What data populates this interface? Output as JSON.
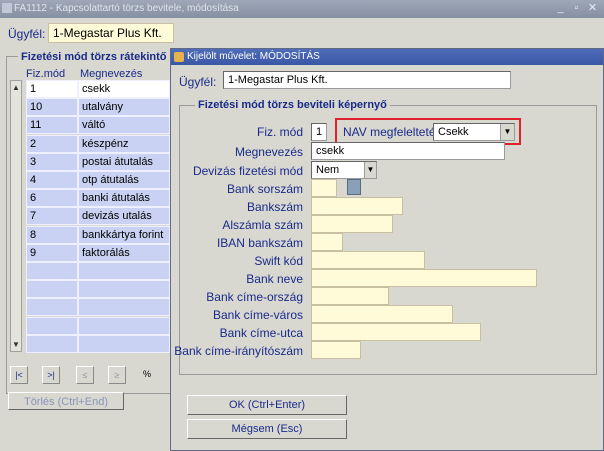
{
  "back_window": {
    "title": "FA1112 - Kapcsolattartó törzs bevitele, módosítása",
    "ugyfel_label": "Ügyfél:",
    "ugyfel_value": "1-Megastar Plus Kft.",
    "table_title": "Fizetési mód törzs rátekintő k",
    "columns": [
      "Fiz.mód",
      "Megnevezés"
    ],
    "rows": [
      {
        "code": "1",
        "name": "csekk"
      },
      {
        "code": "10",
        "name": "utalvány"
      },
      {
        "code": "11",
        "name": "váltó"
      },
      {
        "code": "2",
        "name": "készpénz"
      },
      {
        "code": "3",
        "name": "postai átutalás"
      },
      {
        "code": "4",
        "name": "otp átutalás"
      },
      {
        "code": "6",
        "name": "banki átutalás"
      },
      {
        "code": "7",
        "name": "devizás utalás"
      },
      {
        "code": "8",
        "name": "bankkártya forint"
      },
      {
        "code": "9",
        "name": "faktorálás"
      }
    ],
    "nav_buttons": [
      "|<",
      ">|",
      "≤",
      "≥",
      "%"
    ],
    "delete_button": "Törlés (Ctrl+End)"
  },
  "front_window": {
    "title": "Kijelölt művelet: MÓDOSÍTÁS",
    "ugyfel_label": "Ügyfél:",
    "ugyfel_value": "1-Megastar Plus Kft.",
    "group_title": "Fizetési mód törzs beviteli képernyő",
    "fields": {
      "fiz_mod": {
        "label": "Fiz. mód",
        "value": "1"
      },
      "nav": {
        "label": "NAV megfeleltetés",
        "value": "Csekk"
      },
      "megnevezes": {
        "label": "Megnevezés",
        "value": "csekk"
      },
      "deviza": {
        "label": "Devizás fizetési mód",
        "value": "Nem"
      },
      "bank_sorszam": {
        "label": "Bank sorszám",
        "value": ""
      },
      "bankszam": {
        "label": "Bankszám",
        "value": ""
      },
      "alszamla": {
        "label": "Alszámla szám",
        "value": ""
      },
      "iban": {
        "label": "IBAN bankszám",
        "value": ""
      },
      "swift": {
        "label": "Swift kód",
        "value": ""
      },
      "bank_neve": {
        "label": "Bank neve",
        "value": ""
      },
      "orszag": {
        "label": "Bank címe-ország",
        "value": ""
      },
      "varos": {
        "label": "Bank címe-város",
        "value": ""
      },
      "utca": {
        "label": "Bank címe-utca",
        "value": ""
      },
      "irsz": {
        "label": "Bank címe-irányítószám",
        "value": ""
      }
    },
    "ok_button": "OK (Ctrl+Enter)",
    "cancel_button": "Mégsem (Esc)"
  },
  "colors": {
    "accent_red": "#e0202b",
    "title_blue": "#3a57a6",
    "row_blue": "#c9d2f2"
  }
}
